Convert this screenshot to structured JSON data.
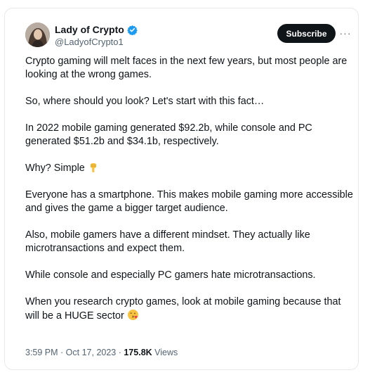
{
  "author": {
    "display_name": "Lady of Crypto",
    "handle": "@LadyofCrypto1",
    "verified_icon": "verified-badge-icon"
  },
  "actions": {
    "subscribe_label": "Subscribe",
    "more_icon": "more-options-icon",
    "more_glyph": "···"
  },
  "tweet": {
    "paragraphs": [
      "Crypto gaming will melt faces in the next few years, but most people are looking at the wrong games.",
      "So, where should you look? Let's start with this fact…",
      "In 2022 mobile gaming generated $92.2b, while console and PC generated $51.2b and $34.1b, respectively.",
      "Why? Simple",
      "Everyone has a smartphone. This makes mobile gaming more accessible and gives the game a bigger target audience.",
      "Also, mobile gamers have a different mindset. They actually like microtransactions and expect them.",
      "While console and especially PC gamers hate microtransactions.",
      "When you research crypto games, look at mobile gaming because that will be a HUGE sector"
    ],
    "emojis": [
      "pointing-down-emoji",
      "kissing-wink-emoji"
    ]
  },
  "meta": {
    "time": "3:59 PM",
    "separator": " · ",
    "date": "Oct 17, 2023",
    "views_count": "175.8K",
    "views_label": " Views"
  },
  "colors": {
    "text": "#0f1419",
    "secondary": "#536471",
    "verified": "#1d9bf0",
    "button": "#0f1419",
    "border": "#e7e9ea"
  }
}
